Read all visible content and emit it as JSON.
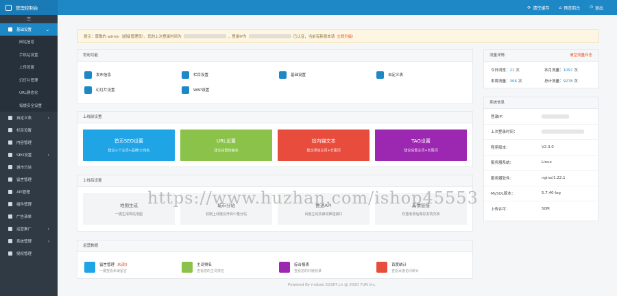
{
  "header": {
    "title": "管理控制台",
    "clear_cache": "清空缓存",
    "preview_site": "预览前台",
    "logout": "退出"
  },
  "sidebar": {
    "toggle_icon": "hamburger-icon",
    "items": [
      {
        "label": "基础设置",
        "active": true,
        "expanded": true
      },
      {
        "label": "自定义表"
      },
      {
        "label": "栏目设置"
      },
      {
        "label": "内容管理"
      },
      {
        "label": "SEO设置"
      },
      {
        "label": "城市分站"
      },
      {
        "label": "留言管理"
      },
      {
        "label": "API管理"
      },
      {
        "label": "插件管理"
      },
      {
        "label": "广告清单"
      },
      {
        "label": "运营推广"
      },
      {
        "label": "系统管理"
      },
      {
        "label": "授权管理"
      }
    ],
    "subitems": [
      "网站信息",
      "手机站设置",
      "上传设置",
      "幻灯片管理",
      "URL静态化",
      "每援安全设置"
    ]
  },
  "notice": {
    "prefix": "提示：尊敬的 admin（超级管理员），您的上次登录时间为",
    "mid": "，登录IP为",
    "verified": "已认证，当前有新版本请",
    "upgrade": "立即升级!"
  },
  "quick_functions": {
    "title": "常用功能",
    "items": [
      {
        "label": "发布信息",
        "icon": "edit-icon"
      },
      {
        "label": "栏目设置",
        "icon": "list-icon"
      },
      {
        "label": "基础设置",
        "icon": "gear-icon"
      },
      {
        "label": "自定义表",
        "icon": "pen-icon"
      },
      {
        "label": "幻灯片设置",
        "icon": "slides-icon"
      },
      {
        "label": "WAP设置",
        "icon": "mobile-gear-icon"
      }
    ]
  },
  "online_settings": {
    "title": "上线前设置",
    "cards": [
      {
        "title": "首页SEO设置",
        "subtitle": "建议三个主词+品牌/公司名",
        "color": "#1fa4e6"
      },
      {
        "title": "URL设置",
        "subtitle": "建议设置伪静态",
        "color": "#8bc34a"
      },
      {
        "title": "站内锚文本",
        "subtitle": "建议添加主词+长尾词",
        "color": "#e84c3d"
      },
      {
        "title": "TAG设置",
        "subtitle": "建议设置主词+长尾词",
        "color": "#9c27b0"
      }
    ]
  },
  "after_settings": {
    "title": "上线后设置",
    "cards": [
      {
        "title": "地图生成",
        "subtitle": "一键生成网站地图"
      },
      {
        "title": "城市分站",
        "subtitle": "初期上线建议开启少量分站"
      },
      {
        "title": "推送API",
        "subtitle": "百度主动及被动推送接口"
      },
      {
        "title": "友情链接",
        "subtitle": "权重收录后做好友情交换"
      }
    ]
  },
  "operations": {
    "title": "运营数据",
    "items": [
      {
        "title": "留言管理",
        "badge": "未读0",
        "subtitle": "一键查看未读留言",
        "color": "#1fa4e6",
        "icon": "message-icon"
      },
      {
        "title": "主词排名",
        "subtitle": "查看您的主词排名",
        "color": "#8bc34a",
        "icon": "bar-chart-icon"
      },
      {
        "title": "综合报表",
        "subtitle": "查看您的外链收录",
        "color": "#9c27b0",
        "icon": "link-icon"
      },
      {
        "title": "百度统计",
        "subtitle": "查看百度访问统计",
        "color": "#e84c3d",
        "icon": "document-icon"
      }
    ]
  },
  "traffic": {
    "title": "流量详情",
    "clear_log": "清空流量日志",
    "today_label": "今日浏览：",
    "today_value": "21",
    "month_label": "本月流量：",
    "month_value": "1097",
    "week_label": "本周流量：",
    "week_value": "306",
    "total_label": "总计流量：",
    "total_value": "9278",
    "unit": "次"
  },
  "system": {
    "title": "系统信息",
    "rows": [
      {
        "k": "登录IP：",
        "v": ""
      },
      {
        "k": "上次登录时间：",
        "v": ""
      },
      {
        "k": "程序版本：",
        "v": "V2.3.0"
      },
      {
        "k": "服务器系统：",
        "v": "Linux"
      },
      {
        "k": "服务器软件：",
        "v": "nginx/1.22.1"
      },
      {
        "k": "MySQL版本：",
        "v": "5.7.40-log"
      },
      {
        "k": "上传许可：",
        "v": "50M"
      }
    ]
  },
  "footer": "Powered By moban.51987.cn @ 2020 YUN Inc.",
  "watermark": "https://www.huzhan.com/ishop45553"
}
